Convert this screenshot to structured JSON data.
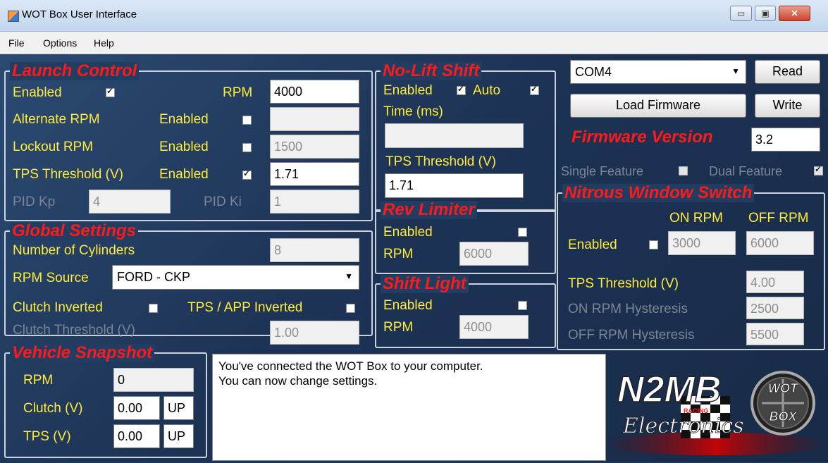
{
  "window": {
    "title": "WOT Box User Interface",
    "minimize": "▭",
    "maximize": "▣",
    "close": "✕"
  },
  "menu": {
    "file": "File",
    "options": "Options",
    "help": "Help"
  },
  "launch_control": {
    "title": "Launch Control",
    "enabled_label": "Enabled",
    "rpm_label": "RPM",
    "rpm_value": "4000",
    "alt_rpm_label": "Alternate RPM",
    "alt_enabled_label": "Enabled",
    "alt_rpm_value": "",
    "lockout_label": "Lockout  RPM",
    "lockout_enabled_label": "Enabled",
    "lockout_value": "1500",
    "tps_label": "TPS Threshold (V)",
    "tps_enabled_label": "Enabled",
    "tps_value": "1.71",
    "pid_kp_label": "PID Kp",
    "pid_kp_value": "4",
    "pid_ki_label": "PID Ki",
    "pid_ki_value": "1"
  },
  "global_settings": {
    "title": "Global Settings",
    "cylinders_label": "Number of Cylinders",
    "cylinders_value": "8",
    "rpm_source_label": "RPM Source",
    "rpm_source_value": "FORD - CKP",
    "clutch_inverted_label": "Clutch Inverted",
    "tps_app_inverted_label": "TPS / APP Inverted",
    "clutch_threshold_label": "Clutch Threshold (V)",
    "clutch_threshold_value": "1.00"
  },
  "vehicle_snapshot": {
    "title": "Vehicle Snapshot",
    "rpm_label": "RPM",
    "rpm_value": "0",
    "clutch_label": "Clutch (V)",
    "clutch_value": "0.00",
    "clutch_state": "UP",
    "tps_label": "TPS (V)",
    "tps_value": "0.00",
    "tps_state": "UP"
  },
  "no_lift_shift": {
    "title": "No-Lift Shift",
    "enabled_label": "Enabled",
    "auto_label": "Auto",
    "time_label": "Time (ms)",
    "time_value": "",
    "tps_label": "TPS Threshold (V)",
    "tps_value": "1.71"
  },
  "rev_limiter": {
    "title": "Rev Limiter",
    "enabled_label": "Enabled",
    "rpm_label": "RPM",
    "rpm_value": "6000"
  },
  "shift_light": {
    "title": "Shift Light",
    "enabled_label": "Enabled",
    "rpm_label": "RPM",
    "rpm_value": "4000"
  },
  "connection": {
    "port_value": "COM4",
    "read_label": "Read",
    "load_firmware_label": "Load Firmware",
    "write_label": "Write",
    "firmware_version_label": "Firmware Version",
    "firmware_version_value": "3.2",
    "single_feature_label": "Single Feature",
    "dual_feature_label": "Dual Feature"
  },
  "nitrous": {
    "title": "Nitrous Window Switch",
    "on_rpm_header": "ON RPM",
    "off_rpm_header": "OFF RPM",
    "enabled_label": "Enabled",
    "on_rpm_value": "3000",
    "off_rpm_value": "6000",
    "tps_label": "TPS Threshold (V)",
    "tps_value": "4.00",
    "on_hyst_label": "ON RPM Hysteresis",
    "on_hyst_value": "2500",
    "off_hyst_label": "OFF RPM Hysteresis",
    "off_hyst_value": "5500"
  },
  "status_message": {
    "line1": "You've connected the WOT Box to your computer.",
    "line2": "You can now change settings."
  },
  "logo": {
    "brand": "N2MB",
    "sub": "Electronics",
    "tag": "RACING",
    "badge_top": "WOT",
    "badge_bottom": "BOX"
  }
}
